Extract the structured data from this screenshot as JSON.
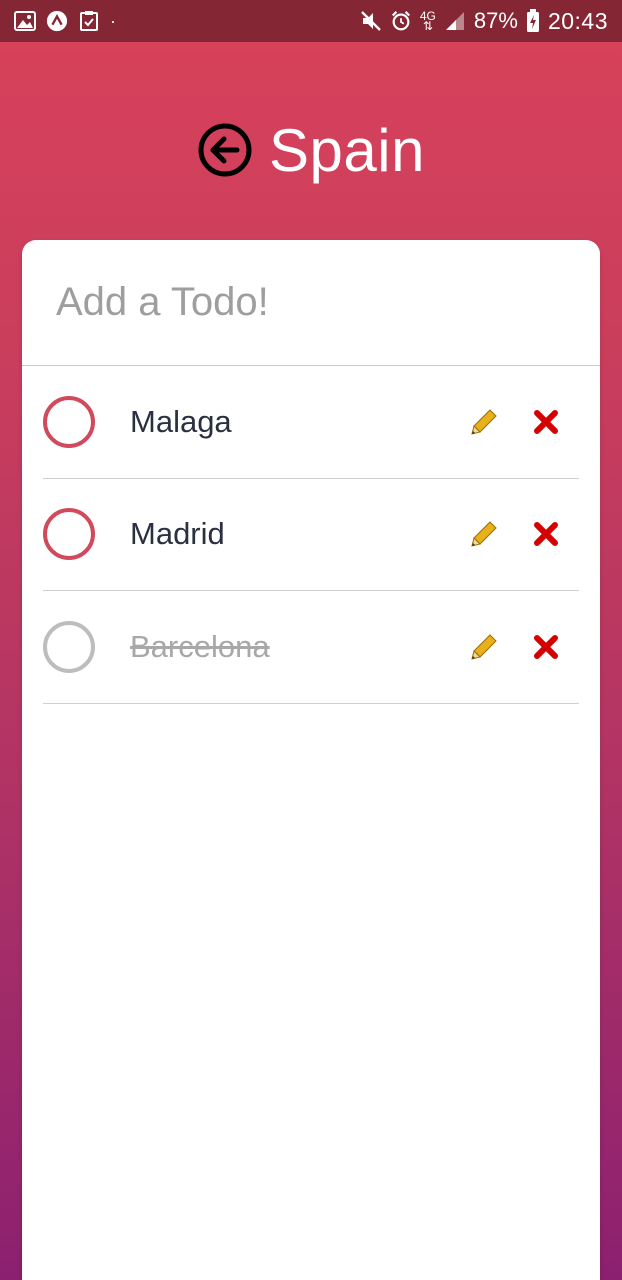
{
  "status_bar": {
    "battery_percent": "87%",
    "time": "20:43",
    "network": "4G",
    "dot": "·",
    "icons": [
      "image-icon",
      "app-icon",
      "task-icon",
      "mute-icon",
      "alarm-icon",
      "network-icon",
      "signal-icon",
      "battery-icon"
    ]
  },
  "header": {
    "title": "Spain",
    "back_icon": "back-arrow-icon"
  },
  "input": {
    "placeholder": "Add a Todo!",
    "value": ""
  },
  "todos": [
    {
      "label": "Malaga",
      "completed": false
    },
    {
      "label": "Madrid",
      "completed": false
    },
    {
      "label": "Barcelona",
      "completed": true
    }
  ],
  "row_actions": {
    "edit_icon": "pencil-icon",
    "delete_icon": "cross-icon"
  },
  "colors": {
    "accent": "#d14a5c",
    "status_bar": "#842634",
    "gradient_top": "#d9425a",
    "gradient_bottom": "#8c2070",
    "completed_gray": "#bdbdbd",
    "delete_red": "#d50000"
  }
}
